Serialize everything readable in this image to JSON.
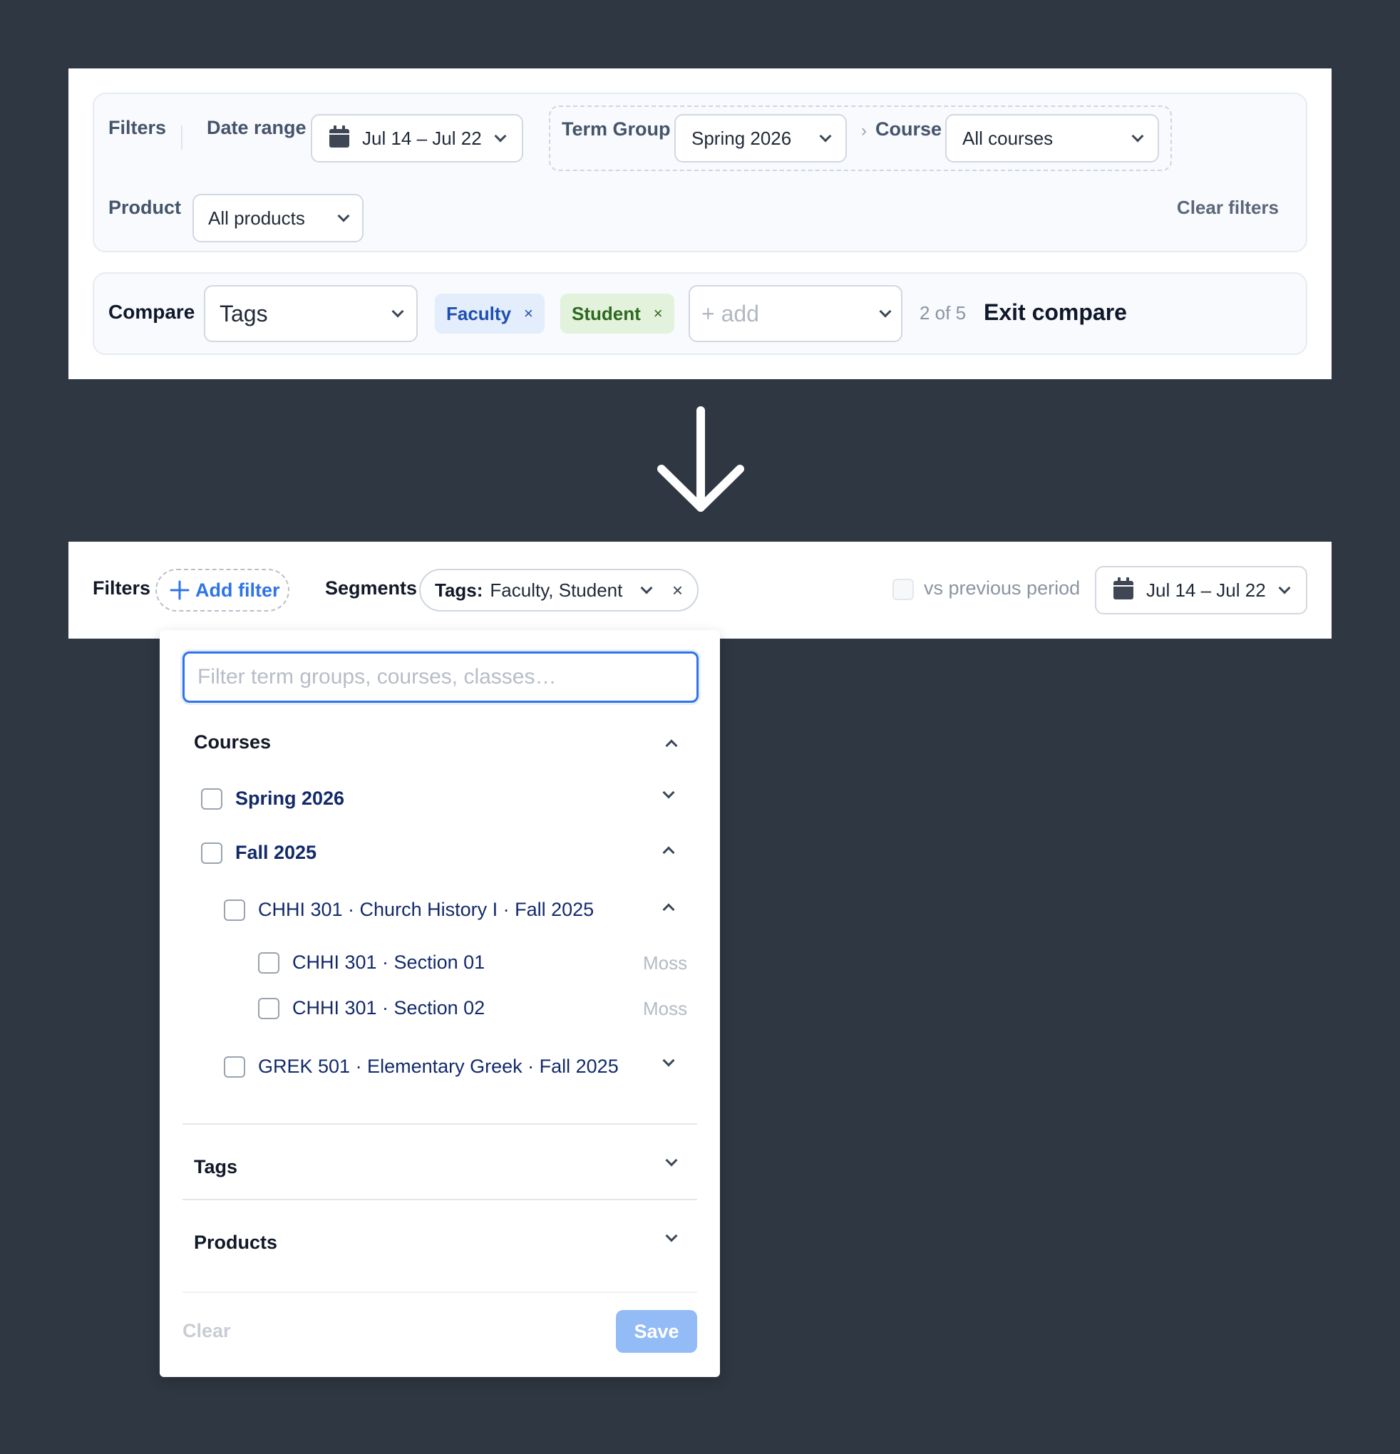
{
  "top_panel": {
    "filters": {
      "label": "Filters",
      "date_range_label": "Date range",
      "date_range_value": "Jul 14 – Jul 22",
      "term_group_label": "Term Group",
      "term_group_value": "Spring 2026",
      "breadcrumb_sep": "›",
      "course_label": "Course",
      "course_value": "All courses",
      "product_label": "Product",
      "product_value": "All products",
      "clear_filters": "Clear filters"
    },
    "compare": {
      "label": "Compare",
      "dimension_value": "Tags",
      "chips": [
        {
          "label": "Faculty",
          "remove": "×"
        },
        {
          "label": "Student",
          "remove": "×"
        }
      ],
      "add_placeholder": "+ add",
      "count": "2 of 5",
      "exit": "Exit compare"
    }
  },
  "bottom_bar": {
    "filters_label": "Filters",
    "add_filter": "Add filter",
    "segments_label": "Segments",
    "segment_key": "Tags:",
    "segment_value": "Faculty, Student",
    "segment_remove": "×",
    "vs_previous": "vs previous period",
    "date_value": "Jul 14 – Jul 22"
  },
  "dropdown": {
    "search_placeholder": "Filter term groups, courses, classes…",
    "courses_title": "Courses",
    "items": {
      "spring": "Spring 2026",
      "fall": "Fall 2025",
      "chhi": "CHHI 301 · Church History I · Fall 2025",
      "sec01": "CHHI 301 · Section 01",
      "sec01_instructor": "Moss",
      "sec02": "CHHI 301 · Section 02",
      "sec02_instructor": "Moss",
      "grek": "GREK 501 · Elementary Greek · Fall 2025"
    },
    "tags_title": "Tags",
    "products_title": "Products",
    "clear": "Clear",
    "save": "Save"
  },
  "colors": {
    "background": "#2e3742",
    "accent_blue": "#2f74e6",
    "faculty_chip_bg": "#e3edfb",
    "faculty_chip_text": "#1e4fae",
    "student_chip_bg": "#e3f2dc",
    "student_chip_text": "#2d6a1f",
    "save_button_bg": "#93bbf5"
  }
}
